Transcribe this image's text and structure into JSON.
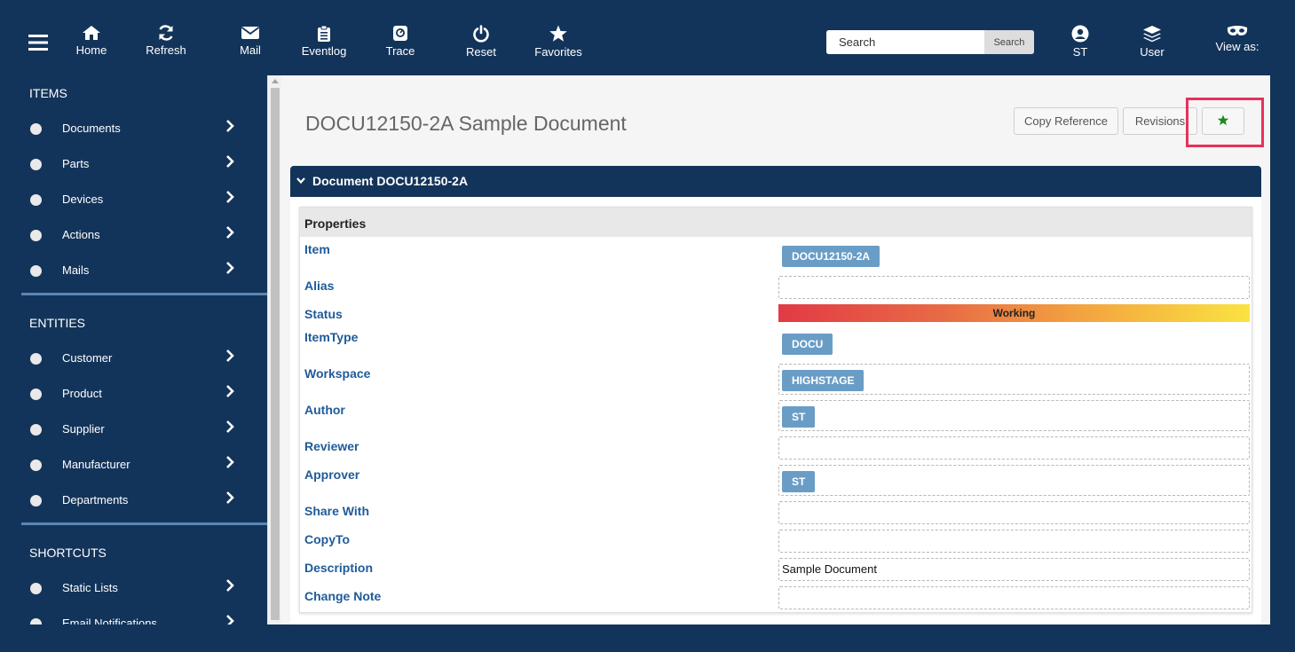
{
  "toolbar": {
    "items": [
      {
        "label": "Home",
        "icon": "home-icon"
      },
      {
        "label": "Refresh",
        "icon": "refresh-icon"
      },
      {
        "label": "Mail",
        "icon": "mail-icon"
      },
      {
        "label": "Eventlog",
        "icon": "clipboard-icon"
      },
      {
        "label": "Trace",
        "icon": "trace-icon"
      },
      {
        "label": "Reset",
        "icon": "power-icon"
      },
      {
        "label": "Favorites",
        "icon": "star-icon"
      }
    ],
    "search": {
      "placeholder": "Search",
      "button_label": "Search"
    },
    "right": [
      {
        "label": "ST",
        "icon": "user-circle-icon"
      },
      {
        "label": "User",
        "icon": "layers-icon"
      },
      {
        "label": "View as:",
        "icon": "mask-icon"
      }
    ]
  },
  "sidebar": {
    "sections": [
      {
        "title": "ITEMS",
        "items": [
          "Documents",
          "Parts",
          "Devices",
          "Actions",
          "Mails"
        ]
      },
      {
        "title": "ENTITIES",
        "items": [
          "Customer",
          "Product",
          "Supplier",
          "Manufacturer",
          "Departments"
        ]
      },
      {
        "title": "SHORTCUTS",
        "items": [
          "Static Lists",
          "Email Notifications"
        ]
      }
    ]
  },
  "page": {
    "title": "DOCU12150-2A Sample Document",
    "buttons": {
      "copy_reference": "Copy Reference",
      "revisions": "Revisions"
    }
  },
  "panel": {
    "title": "Document DOCU12150-2A",
    "properties_title": "Properties",
    "labels": {
      "item": "Item",
      "alias": "Alias",
      "status": "Status",
      "itemtype": "ItemType",
      "workspace": "Workspace",
      "author": "Author",
      "reviewer": "Reviewer",
      "approver": "Approver",
      "share_with": "Share With",
      "copyto": "CopyTo",
      "description": "Description",
      "change_note": "Change Note"
    },
    "values": {
      "item": "DOCU12150-2A",
      "status": "Working",
      "itemtype": "DOCU",
      "workspace": "HIGHSTAGE",
      "author": "ST",
      "approver": "ST",
      "description": "Sample Document"
    }
  },
  "colors": {
    "nav_bg": "#13345a",
    "label_blue": "#1f5b99",
    "chip_blue": "#6a9dc6",
    "highlight": "#e8315a",
    "star_green": "#1c8a1c"
  }
}
